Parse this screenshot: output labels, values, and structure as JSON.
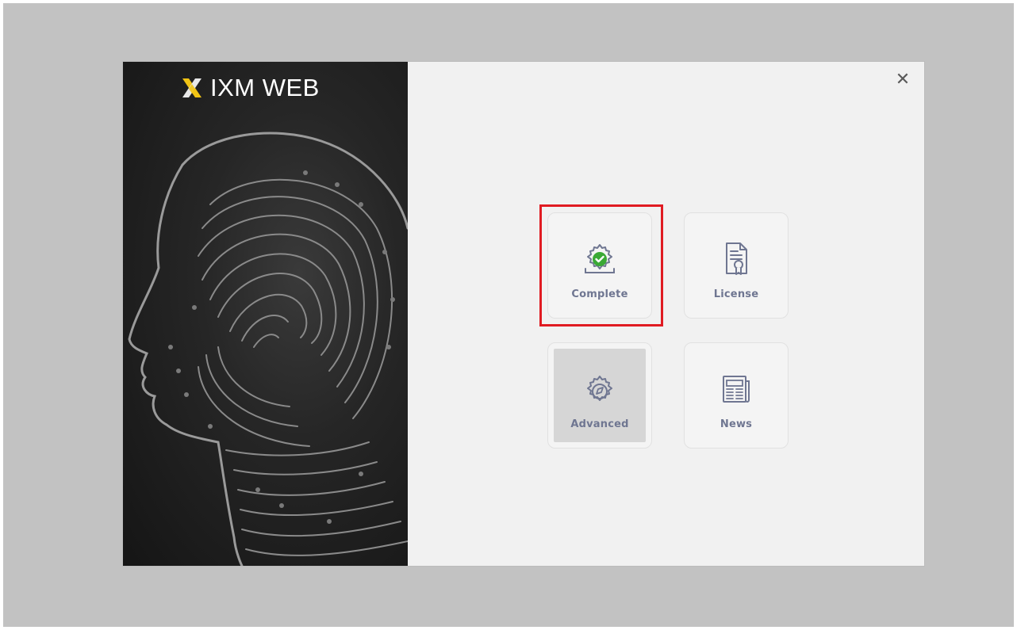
{
  "brand": {
    "name": "IXM WEB",
    "logo_icon": "ixm-x-logo-icon",
    "accent_color": "#f2c414"
  },
  "dialog": {
    "close_label": "✕",
    "highlight_color": "#e01b22"
  },
  "tiles": [
    {
      "label": "Complete",
      "icon": "gear-check-icon",
      "selected": true
    },
    {
      "label": "License",
      "icon": "license-certificate-icon",
      "selected": false
    },
    {
      "label": "Advanced",
      "icon": "gear-compass-icon",
      "selected": false
    },
    {
      "label": "News",
      "icon": "newspaper-icon",
      "selected": false
    }
  ],
  "colors": {
    "tile_label": "#6f7691",
    "check_badge": "#3aa935",
    "panel_background": "#f1f1f1",
    "frame_background": "#c2c2c2"
  }
}
